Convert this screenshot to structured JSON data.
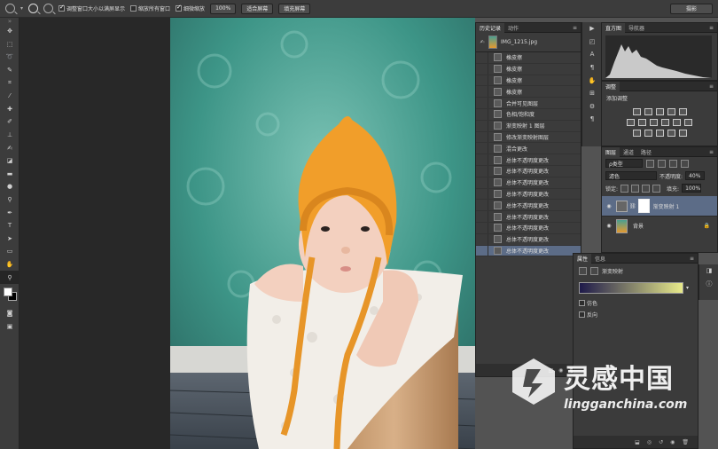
{
  "options_bar": {
    "resize_label": "调整窗口大小以满屏显示",
    "zoom_all_label": "缩放所有窗口",
    "scrubby_label": "细微缩放",
    "zoom_value": "100%",
    "fit_screen": "适合屏幕",
    "fill_screen": "填充屏幕",
    "workspace": "摄影"
  },
  "history_panel": {
    "tabs": [
      "历史记录",
      "动作"
    ],
    "snapshot": "IMG_1215.jpg",
    "items": [
      "橡皮擦",
      "橡皮擦",
      "橡皮擦",
      "橡皮擦",
      "合并可见图层",
      "色相/饱和度",
      "渐变映射 1 图层",
      "修改渐变映射图层",
      "混合更改",
      "总体不透明度更改",
      "总体不透明度更改",
      "总体不透明度更改",
      "总体不透明度更改",
      "总体不透明度更改",
      "总体不透明度更改",
      "总体不透明度更改",
      "总体不透明度更改",
      "总体不透明度更改"
    ]
  },
  "histogram_panel": {
    "tabs": [
      "直方图",
      "导航器"
    ]
  },
  "adjust_panel": {
    "tabs": [
      "调整"
    ],
    "add_label": "添加调整"
  },
  "layers_panel": {
    "tabs": [
      "图层",
      "通道",
      "路径"
    ],
    "filter": "ρ类型",
    "blend_mode": "滤色",
    "opacity_label": "不透明度:",
    "opacity_value": "40%",
    "lock_label": "锁定:",
    "fill_label": "填充:",
    "fill_value": "100%",
    "layers": [
      {
        "name": "渐变映射 1"
      },
      {
        "name": "背景"
      }
    ]
  },
  "properties_panel": {
    "tabs": [
      "属性",
      "信息"
    ],
    "title": "渐变映射",
    "gradient_start": "#1e1a4a",
    "gradient_end": "#e8ea8a",
    "dither_label": "仿色",
    "reverse_label": "反向"
  },
  "watermark": {
    "brand": "灵感中国",
    "url": "lingganchina.com"
  }
}
